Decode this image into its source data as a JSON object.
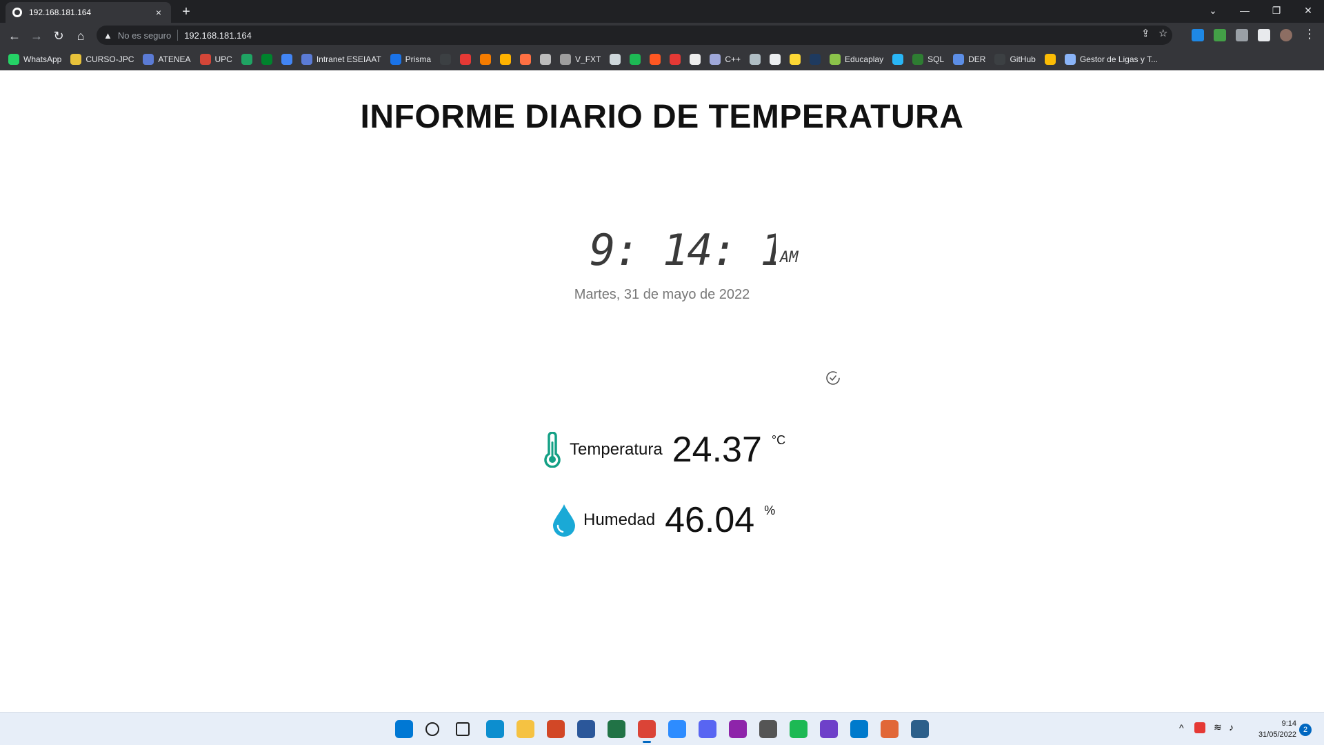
{
  "browser": {
    "tab_title": "192.168.181.164",
    "tab_close": "×",
    "new_tab": "+",
    "security_label": "No es seguro",
    "url": "192.168.181.164"
  },
  "bookmarks": [
    {
      "label": "WhatsApp",
      "color": "#25d366",
      "icon": "whatsapp-icon"
    },
    {
      "label": "CURSO-JPC",
      "color": "#e8c23a",
      "icon": "folder-icon"
    },
    {
      "label": "ATENEA",
      "color": "#5b7bd5",
      "icon": "globe-icon"
    },
    {
      "label": "UPC",
      "color": "#d44638",
      "icon": "gmail-icon"
    },
    {
      "label": "",
      "color": "#1fa463",
      "icon": "drive-icon"
    },
    {
      "label": "",
      "color": "#00832d",
      "icon": "meet-icon"
    },
    {
      "label": "",
      "color": "#4285f4",
      "icon": "docs-icon"
    },
    {
      "label": "Intranet ESEIAAT",
      "color": "#5b7bd5",
      "icon": "globe-icon"
    },
    {
      "label": "Prisma",
      "color": "#1a73e8",
      "icon": "globe-icon"
    },
    {
      "label": "",
      "color": "#3c4043",
      "icon": "github-icon"
    },
    {
      "label": "",
      "color": "#e53935",
      "icon": "sy-icon"
    },
    {
      "label": "",
      "color": "#f57c00",
      "icon": "gear-orange-icon"
    },
    {
      "label": "",
      "color": "#ffb300",
      "icon": "d-icon"
    },
    {
      "label": "",
      "color": "#ff7043",
      "icon": "pdf-icon"
    },
    {
      "label": "",
      "color": "#bdbdbd",
      "icon": "circle-icon"
    },
    {
      "label": "V_FXT",
      "color": "#9e9e9e",
      "icon": "globe-icon"
    },
    {
      "label": "",
      "color": "#cfd8dc",
      "icon": "circle-icon"
    },
    {
      "label": "",
      "color": "#1db954",
      "icon": "spotify-icon"
    },
    {
      "label": "",
      "color": "#ff5722",
      "icon": "check-icon"
    },
    {
      "label": "",
      "color": "#e53935",
      "icon": "sc-icon"
    },
    {
      "label": "",
      "color": "#eeeeee",
      "icon": "toggle-icon"
    },
    {
      "label": "C++",
      "color": "#9fa8da",
      "icon": "cpp-icon"
    },
    {
      "label": "",
      "color": "#b0bec5",
      "icon": "chart-icon"
    },
    {
      "label": "",
      "color": "#eceff1",
      "icon": "calc-icon"
    },
    {
      "label": "",
      "color": "#fdd835",
      "icon": "banner-icon"
    },
    {
      "label": "",
      "color": "#1e3a5f",
      "icon": "globe-dark-icon"
    },
    {
      "label": "Educaplay",
      "color": "#8bc34a",
      "icon": "educaplay-icon"
    },
    {
      "label": "",
      "color": "#29b6f6",
      "icon": "globe-icon"
    },
    {
      "label": "SQL",
      "color": "#2e7d32",
      "icon": "w3-icon"
    },
    {
      "label": "DER",
      "color": "#5c8ee6",
      "icon": "star-icon"
    },
    {
      "label": "GitHub",
      "color": "#3c4043",
      "icon": "github-icon"
    },
    {
      "label": "",
      "color": "#fbbc05",
      "icon": "dots-icon"
    },
    {
      "label": "Gestor de Ligas y T...",
      "color": "#8ab4f8",
      "icon": "people-icon"
    }
  ],
  "page": {
    "heading": "INFORME DIARIO DE TEMPERATURA",
    "clock": {
      "time": "9: 14: 19",
      "ampm": "AM"
    },
    "date": "Martes, 31 de mayo de 2022",
    "temperature": {
      "label": "Temperatura",
      "value": "24.37",
      "unit": "°C",
      "color": "#14a085"
    },
    "humidity": {
      "label": "Humedad",
      "value": "46.04",
      "unit": "%",
      "color": "#1aa9d6"
    }
  },
  "taskbar": {
    "apps": [
      {
        "name": "start-icon",
        "color": "#0078d4"
      },
      {
        "name": "search-icon",
        "color": "#202020"
      },
      {
        "name": "task-view-icon",
        "color": "#202020"
      },
      {
        "name": "edge-icon",
        "color": "#0c8ecf"
      },
      {
        "name": "file-explorer-icon",
        "color": "#f5c242"
      },
      {
        "name": "powerpoint-icon",
        "color": "#d24726"
      },
      {
        "name": "word-icon",
        "color": "#2b579a"
      },
      {
        "name": "excel-icon",
        "color": "#217346"
      },
      {
        "name": "chrome-icon",
        "color": "#db4437"
      },
      {
        "name": "zoom-icon",
        "color": "#2d8cff"
      },
      {
        "name": "discord-icon",
        "color": "#5865f2"
      },
      {
        "name": "winrar-icon",
        "color": "#8e24aa"
      },
      {
        "name": "wireshark-icon",
        "color": "#555555"
      },
      {
        "name": "spotify-icon",
        "color": "#1db954"
      },
      {
        "name": "github-desktop-icon",
        "color": "#6e40c9"
      },
      {
        "name": "vscode-icon",
        "color": "#007acc"
      },
      {
        "name": "matlab-icon",
        "color": "#e16737"
      },
      {
        "name": "sql-developer-icon",
        "color": "#2c5f8a"
      }
    ],
    "time": "9:14",
    "date": "31/05/2022",
    "notifications": "2"
  }
}
